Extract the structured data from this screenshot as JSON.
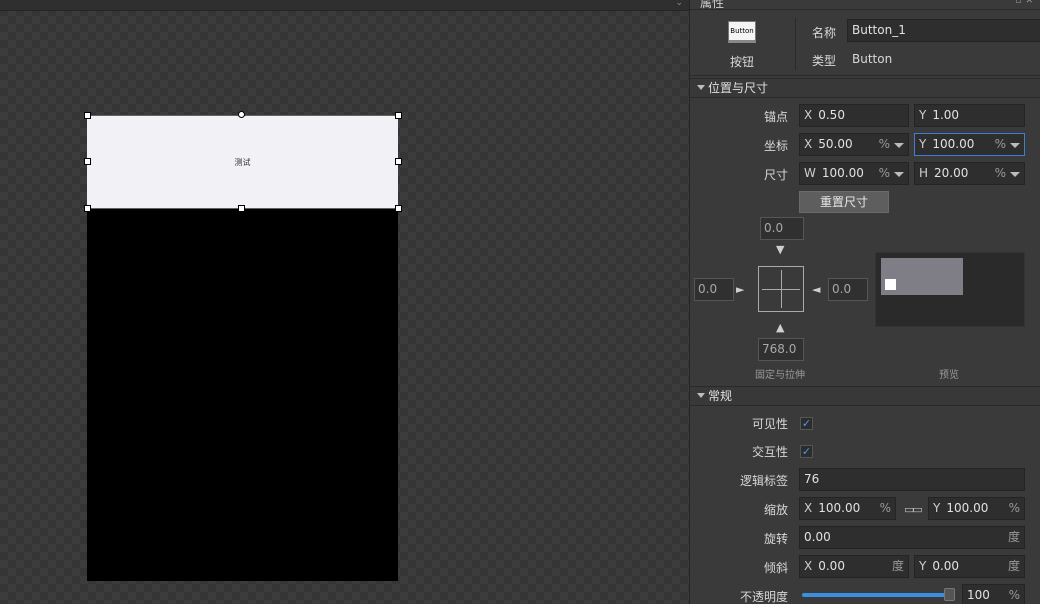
{
  "canvas": {
    "button_text": "测试"
  },
  "panel": {
    "title": "属性",
    "type_thumb_text": "Button",
    "type_caption": "按钮",
    "name_label": "名称",
    "name_value": "Button_1",
    "type_label": "类型",
    "type_value": "Button"
  },
  "position_section": {
    "header": "位置与尺寸",
    "anchor_label": "锚点",
    "anchor_x_axis": "X",
    "anchor_x": "0.50",
    "anchor_y_axis": "Y",
    "anchor_y": "1.00",
    "coord_label": "坐标",
    "coord_x_axis": "X",
    "coord_x": "50.00",
    "coord_x_unit": "%",
    "coord_y_axis": "Y",
    "coord_y": "100.00",
    "coord_y_unit": "%",
    "size_label": "尺寸",
    "size_w_axis": "W",
    "size_w": "100.00",
    "size_w_unit": "%",
    "size_h_axis": "H",
    "size_h": "20.00",
    "size_h_unit": "%",
    "reset_button": "重置尺寸",
    "margin_top": "0.0",
    "margin_left": "0.0",
    "margin_right": "0.0",
    "margin_bottom": "768.0",
    "anchor_caption": "固定与拉伸",
    "preview_caption": "预览"
  },
  "general_section": {
    "header": "常规",
    "visible_label": "可见性",
    "visible_checked": true,
    "interactive_label": "交互性",
    "interactive_checked": true,
    "tag_label": "逻辑标签",
    "tag_value": "76",
    "scale_label": "缩放",
    "scale_x_axis": "X",
    "scale_x": "100.00",
    "scale_x_unit": "%",
    "scale_y_axis": "Y",
    "scale_y": "100.00",
    "scale_y_unit": "%",
    "rotation_label": "旋转",
    "rotation_value": "0.00",
    "rotation_unit": "度",
    "skew_label": "倾斜",
    "skew_x_axis": "X",
    "skew_x": "0.00",
    "skew_x_unit": "度",
    "skew_y_axis": "Y",
    "skew_y": "0.00",
    "skew_y_unit": "度",
    "opacity_label": "不透明度",
    "opacity_value": "100",
    "opacity_unit": "%",
    "opacity_fraction": 1.0,
    "check_glyph": "✓"
  },
  "colors": {
    "accent": "#3b8fe0",
    "focus_border": "#3f7fd0",
    "stage": "#000000",
    "button_bg": "#f2f2f6",
    "preview_rect": "#7f7e87"
  }
}
